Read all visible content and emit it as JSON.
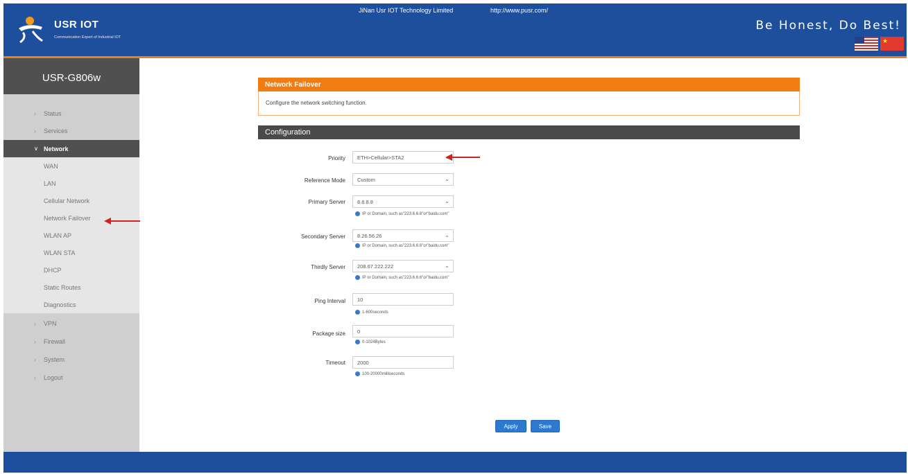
{
  "header": {
    "logo_title": "USR IOT",
    "logo_subtitle": "Communication Expert of Industrial IOT",
    "slogan": "Be Honest, Do Best!",
    "colors": {
      "header_bg": "#1d4f9c",
      "accent_line": "#ef7d1a"
    }
  },
  "sidebar": {
    "device_name": "USR-G806w",
    "menu": {
      "status": "Status",
      "services": "Services",
      "network": "Network",
      "vpn": "VPN",
      "firewall": "Firewall",
      "system": "System",
      "logout": "Logout"
    },
    "network_items": [
      "WAN",
      "LAN",
      "Cellular Network",
      "Network Failover",
      "WLAN AP",
      "WLAN STA",
      "DHCP",
      "Static Routes",
      "Diagnostics"
    ],
    "active_item": "Network Failover"
  },
  "main": {
    "section_title": "Network Failover",
    "section_desc": "Configure the network switching function.",
    "config_title": "Configuration",
    "fields": {
      "priority": {
        "label": "Priority",
        "value": "ETH>Cellular>STA2"
      },
      "reference_mode": {
        "label": "Reference Mode",
        "value": "Custom"
      },
      "primary_server": {
        "label": "Primary Server",
        "value": "8.8.8.8",
        "hint": "IP or Domain, such as\"223.6.6.6\"or\"baidu.com\""
      },
      "secondary_server": {
        "label": "Secondary Server",
        "value": "8.26.56.26",
        "hint": "IP or Domain, such as\"223.6.6.6\"or\"baidu.com\""
      },
      "thirdly_server": {
        "label": "Thirdly Server",
        "value": "208.67.222.222",
        "hint": "IP or Domain, such as\"223.6.6.6\"or\"baidu.com\""
      },
      "ping_interval": {
        "label": "Ping Interval",
        "value": "10",
        "hint": "1-600seconds"
      },
      "package_size": {
        "label": "Package size",
        "value": "0",
        "hint": "0-1024Bytes"
      },
      "timeout": {
        "label": "Timeout",
        "value": "2000",
        "hint": "100-20000milliseconds"
      }
    },
    "buttons": {
      "apply": "Apply",
      "save": "Save"
    },
    "colors": {
      "section_header": "#f07d12",
      "config_header": "#4a4a4a",
      "button": "#2c7ad0",
      "annotation_arrow": "#d0231d"
    }
  },
  "footer": {
    "company": "JiNan Usr IOT Technology Limited",
    "url": "http://www.pusr.com/"
  }
}
